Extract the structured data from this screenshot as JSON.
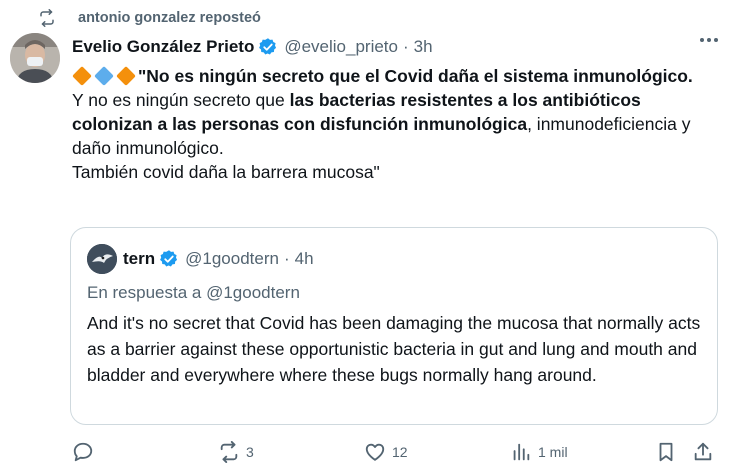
{
  "repost": {
    "text": "antonio gonzalez reposteó"
  },
  "tweet": {
    "author_name": "Evelio González Prieto",
    "handle": "@evelio_prieto",
    "separator": "·",
    "time": "3h",
    "lines": {
      "l1_bold": "\"No es ningún secreto que el Covid daña el sistema inmunológico.",
      "l2_start": "Y no es ningún secreto que ",
      "l2_bold": "las bacterias resistentes a los antibióticos colonizan a las personas con disfunción inmunológica",
      "l2_end": ", inmunodeficiencia y daño inmunológico.",
      "l3": "También covid daña la barrera mucosa\""
    }
  },
  "quote": {
    "author_name": "tern",
    "handle": "@1goodtern",
    "separator": "·",
    "time": "4h",
    "reply_to": "En respuesta a @1goodtern",
    "text": "And it's no secret that Covid has been damaging the mucosa that normally acts as a barrier against these opportunistic bacteria in gut and lung and mouth and bladder and everywhere where these bugs normally hang around."
  },
  "actions": {
    "reposts": "3",
    "likes": "12",
    "views": "1 mil"
  },
  "colors": {
    "text": "#0f1419",
    "secondary": "#536471",
    "verified": "#1d9bf0",
    "border": "#cfd9de"
  },
  "icons": [
    "repost-icon",
    "verified-badge-icon",
    "more-icon",
    "reply-icon",
    "like-icon",
    "views-icon",
    "bookmark-icon",
    "share-icon"
  ]
}
